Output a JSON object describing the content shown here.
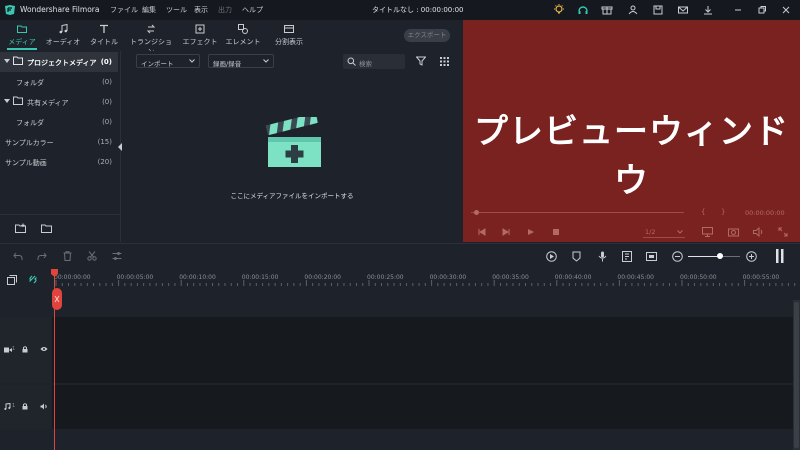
{
  "app": {
    "name": "Wondershare Filmora",
    "doc_title": "タイトルなし : 00:00:00:00"
  },
  "menu": [
    "ファイル",
    "編集",
    "ツール",
    "表示",
    "出力",
    "ヘルプ"
  ],
  "tabs": [
    "メディア",
    "オーディオ",
    "タイトル",
    "トランジション",
    "エフェクト",
    "エレメント",
    "分割表示"
  ],
  "export_label": "エクスポート",
  "sidebar": {
    "items": [
      {
        "label": "プロジェクトメディア",
        "count": "(0)"
      },
      {
        "label": "フォルダ",
        "count": "(0)"
      },
      {
        "label": "共有メディア",
        "count": "(0)"
      },
      {
        "label": "フォルダ",
        "count": "(0)"
      },
      {
        "label": "サンプルカラー",
        "count": "(15)"
      },
      {
        "label": "サンプル動画",
        "count": "(20)"
      }
    ]
  },
  "media": {
    "import_dropdown": "インポート",
    "record_dropdown": "録画/録音",
    "search_placeholder": "検索",
    "import_hint": "ここにメディアファイルをインポートする"
  },
  "preview": {
    "overlay_text": "プレビューウィンドウ",
    "timecode": "00:00:00:00",
    "quality": "1/2"
  },
  "timeline": {
    "ticks": [
      "00:00:00:00",
      "00:00:05:00",
      "00:00:10:00",
      "00:00:15:00",
      "00:00:20:00",
      "00:00:25:00",
      "00:00:30:00",
      "00:00:35:00",
      "00:00:40:00",
      "00:00:45:00",
      "00:00:50:00",
      "00:00:55:00"
    ],
    "video_track_number": "1",
    "audio_track_number": "1"
  },
  "colors": {
    "accent": "#39c7b1",
    "preview_bg": "#7a2220",
    "playhead": "#e0443c"
  }
}
